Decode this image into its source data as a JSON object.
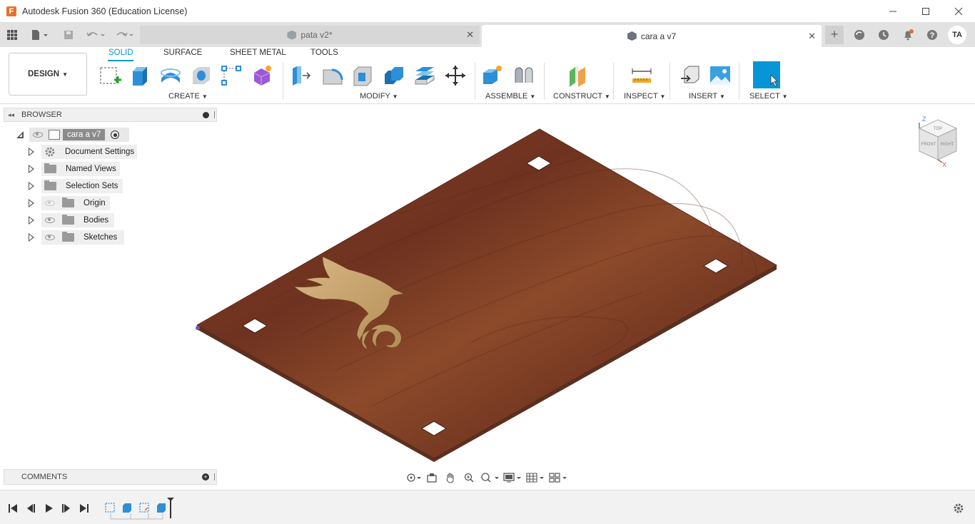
{
  "window": {
    "title": "Autodesk Fusion 360 (Education License)",
    "logo": "F",
    "controls": [
      "minimize-icon",
      "maximize-icon",
      "close-icon"
    ]
  },
  "tabs": [
    {
      "label": "pata v2*",
      "active": false
    },
    {
      "label": "cara a v7",
      "active": true
    }
  ],
  "user": {
    "initials": "TA"
  },
  "ribbon": {
    "workspace": "DESIGN",
    "tabs": [
      "SOLID",
      "SURFACE",
      "SHEET METAL",
      "TOOLS"
    ],
    "active_tab": "SOLID",
    "groups": [
      "CREATE",
      "MODIFY",
      "ASSEMBLE",
      "CONSTRUCT",
      "INSPECT",
      "INSERT",
      "SELECT"
    ]
  },
  "browser": {
    "title": "BROWSER",
    "root": "cara a v7",
    "items": [
      {
        "label": "Document Settings",
        "icon": "gear-icon",
        "eye": "none"
      },
      {
        "label": "Named Views",
        "icon": "folder-icon",
        "eye": "none"
      },
      {
        "label": "Selection Sets",
        "icon": "folder-icon",
        "eye": "none"
      },
      {
        "label": "Origin",
        "icon": "folder-icon",
        "eye": "hidden"
      },
      {
        "label": "Bodies",
        "icon": "folder-icon",
        "eye": "visible"
      },
      {
        "label": "Sketches",
        "icon": "folder-icon",
        "eye": "visible"
      }
    ]
  },
  "viewcube": {
    "top": "TOP",
    "front": "FRONT",
    "right": "RIGHT",
    "axis_z": "Z",
    "axis_x": "X"
  },
  "comments": {
    "title": "COMMENTS"
  },
  "colors": {
    "accent": "#0696d7",
    "wood": "#7a3a22",
    "inlay": "#c9a46b"
  }
}
